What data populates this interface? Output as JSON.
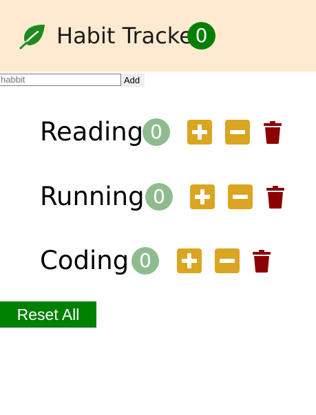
{
  "header": {
    "title": "Habit Tracker",
    "total_count": "0",
    "logo_icon": "leaf-icon"
  },
  "form": {
    "input_value": "",
    "input_placeholder": "habbit",
    "add_label": "Add"
  },
  "habits": [
    {
      "name": "Reading",
      "count": "0"
    },
    {
      "name": "Running",
      "count": "0"
    },
    {
      "name": "Coding",
      "count": "0"
    }
  ],
  "icons": {
    "increment": "plus-square-icon",
    "decrement": "minus-square-icon",
    "delete": "trash-icon"
  },
  "reset_label": "Reset All",
  "colors": {
    "header_bg": "#feead0",
    "accent_green": "#008000",
    "count_badge": "#8fbc8f",
    "action_gold": "#daa520",
    "delete_red": "#8b0000"
  }
}
